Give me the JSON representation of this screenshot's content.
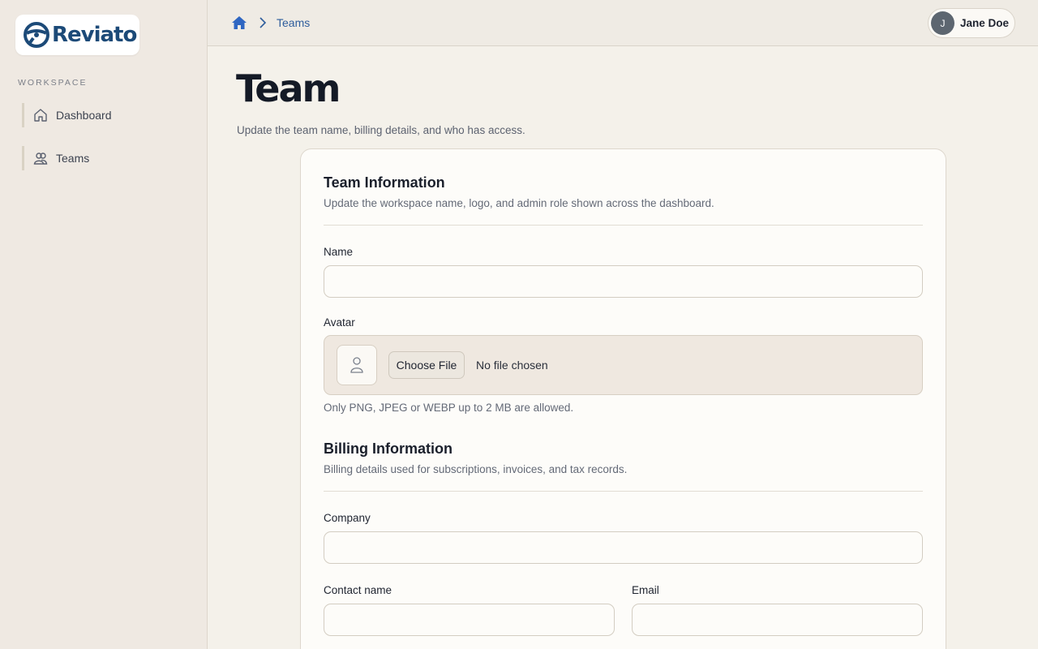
{
  "brand": {
    "name": "Reviato"
  },
  "sidebar": {
    "section_label": "WORKSPACE",
    "items": [
      {
        "label": "Dashboard",
        "icon": "home-icon"
      },
      {
        "label": "Teams",
        "icon": "users-icon"
      }
    ]
  },
  "header": {
    "breadcrumb": {
      "home_icon": "home-icon",
      "current": "Teams"
    },
    "user": {
      "initial": "J",
      "name": "Jane Doe"
    }
  },
  "page": {
    "title": "Team",
    "subtitle": "Update the team name, billing details, and who has access."
  },
  "team_info": {
    "title": "Team Information",
    "description": "Update the workspace name, logo, and admin role shown across the dashboard.",
    "name_label": "Name",
    "name_value": "",
    "avatar_label": "Avatar",
    "choose_file_label": "Choose File",
    "no_file_text": "No file chosen",
    "avatar_hint": "Only PNG, JPEG or WEBP up to 2 MB are allowed."
  },
  "billing_info": {
    "title": "Billing Information",
    "description": "Billing details used for subscriptions, invoices, and tax records.",
    "company_label": "Company",
    "company_value": "",
    "contact_label": "Contact name",
    "contact_value": "",
    "email_label": "Email",
    "email_value": ""
  },
  "colors": {
    "brand": "#1c4a78",
    "link": "#2e5d9c",
    "background": "#f4f1ea",
    "sidebar": "#efe9e2",
    "card": "#fdfcf9"
  }
}
